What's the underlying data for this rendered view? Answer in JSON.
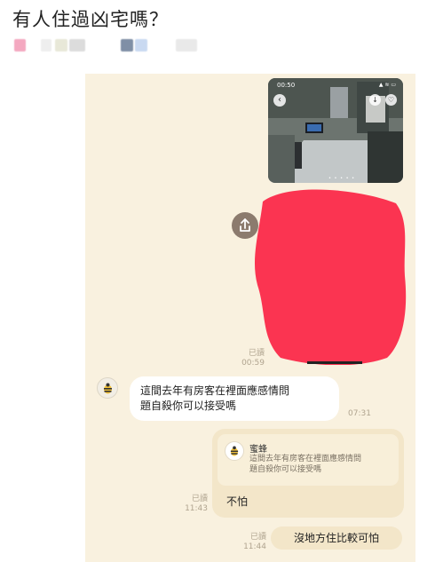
{
  "post": {
    "title": "有人住過凶宅嗎？",
    "blurred_meta_colors": [
      "#f4a8c0",
      "#eeeeee",
      "#e8e8d8",
      "#dcdcdc",
      "#7f8fa6",
      "#c9d9f1",
      "#e9e9e9"
    ]
  },
  "chat": {
    "background": "#f9f1df",
    "photo": {
      "status_time": "00:50",
      "status_icons": "▲ ≋ ▭",
      "back_icon": "‹",
      "dots": "• • • • •"
    },
    "redaction_color": "#fb3451",
    "first_message_meta": {
      "read": "已讀",
      "time": "00:59"
    },
    "incoming": {
      "sender": "蜜蜂",
      "line1": "這間去年有房客在裡面應感情問",
      "line2": "題自殺你可以接受嗎",
      "time": "07:31"
    },
    "reply": {
      "quote_name": "蜜蜂",
      "quote_line1": "這間去年有房客在裡面應感情問",
      "quote_line2": "題自殺你可以接受嗎",
      "text": "不怕",
      "read": "已讀",
      "time": "11:43"
    },
    "last": {
      "text": "沒地方住比較可怕",
      "read": "已讀",
      "time": "11:44"
    }
  }
}
